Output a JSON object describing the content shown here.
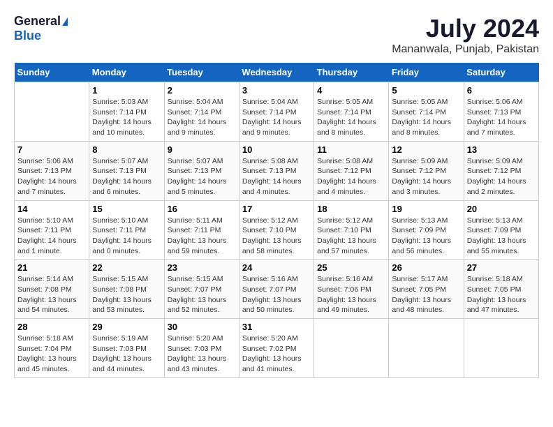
{
  "header": {
    "logo_general": "General",
    "logo_blue": "Blue",
    "month_title": "July 2024",
    "location": "Mananwala, Punjab, Pakistan"
  },
  "weekdays": [
    "Sunday",
    "Monday",
    "Tuesday",
    "Wednesday",
    "Thursday",
    "Friday",
    "Saturday"
  ],
  "weeks": [
    [
      {
        "day": null
      },
      {
        "day": "1",
        "sunrise": "5:03 AM",
        "sunset": "7:14 PM",
        "daylight": "14 hours and 10 minutes."
      },
      {
        "day": "2",
        "sunrise": "5:04 AM",
        "sunset": "7:14 PM",
        "daylight": "14 hours and 9 minutes."
      },
      {
        "day": "3",
        "sunrise": "5:04 AM",
        "sunset": "7:14 PM",
        "daylight": "14 hours and 9 minutes."
      },
      {
        "day": "4",
        "sunrise": "5:05 AM",
        "sunset": "7:14 PM",
        "daylight": "14 hours and 8 minutes."
      },
      {
        "day": "5",
        "sunrise": "5:05 AM",
        "sunset": "7:14 PM",
        "daylight": "14 hours and 8 minutes."
      },
      {
        "day": "6",
        "sunrise": "5:06 AM",
        "sunset": "7:13 PM",
        "daylight": "14 hours and 7 minutes."
      }
    ],
    [
      {
        "day": "7",
        "sunrise": "5:06 AM",
        "sunset": "7:13 PM",
        "daylight": "14 hours and 7 minutes."
      },
      {
        "day": "8",
        "sunrise": "5:07 AM",
        "sunset": "7:13 PM",
        "daylight": "14 hours and 6 minutes."
      },
      {
        "day": "9",
        "sunrise": "5:07 AM",
        "sunset": "7:13 PM",
        "daylight": "14 hours and 5 minutes."
      },
      {
        "day": "10",
        "sunrise": "5:08 AM",
        "sunset": "7:13 PM",
        "daylight": "14 hours and 4 minutes."
      },
      {
        "day": "11",
        "sunrise": "5:08 AM",
        "sunset": "7:12 PM",
        "daylight": "14 hours and 4 minutes."
      },
      {
        "day": "12",
        "sunrise": "5:09 AM",
        "sunset": "7:12 PM",
        "daylight": "14 hours and 3 minutes."
      },
      {
        "day": "13",
        "sunrise": "5:09 AM",
        "sunset": "7:12 PM",
        "daylight": "14 hours and 2 minutes."
      }
    ],
    [
      {
        "day": "14",
        "sunrise": "5:10 AM",
        "sunset": "7:11 PM",
        "daylight": "14 hours and 1 minute."
      },
      {
        "day": "15",
        "sunrise": "5:10 AM",
        "sunset": "7:11 PM",
        "daylight": "14 hours and 0 minutes."
      },
      {
        "day": "16",
        "sunrise": "5:11 AM",
        "sunset": "7:11 PM",
        "daylight": "13 hours and 59 minutes."
      },
      {
        "day": "17",
        "sunrise": "5:12 AM",
        "sunset": "7:10 PM",
        "daylight": "13 hours and 58 minutes."
      },
      {
        "day": "18",
        "sunrise": "5:12 AM",
        "sunset": "7:10 PM",
        "daylight": "13 hours and 57 minutes."
      },
      {
        "day": "19",
        "sunrise": "5:13 AM",
        "sunset": "7:09 PM",
        "daylight": "13 hours and 56 minutes."
      },
      {
        "day": "20",
        "sunrise": "5:13 AM",
        "sunset": "7:09 PM",
        "daylight": "13 hours and 55 minutes."
      }
    ],
    [
      {
        "day": "21",
        "sunrise": "5:14 AM",
        "sunset": "7:08 PM",
        "daylight": "13 hours and 54 minutes."
      },
      {
        "day": "22",
        "sunrise": "5:15 AM",
        "sunset": "7:08 PM",
        "daylight": "13 hours and 53 minutes."
      },
      {
        "day": "23",
        "sunrise": "5:15 AM",
        "sunset": "7:07 PM",
        "daylight": "13 hours and 52 minutes."
      },
      {
        "day": "24",
        "sunrise": "5:16 AM",
        "sunset": "7:07 PM",
        "daylight": "13 hours and 50 minutes."
      },
      {
        "day": "25",
        "sunrise": "5:16 AM",
        "sunset": "7:06 PM",
        "daylight": "13 hours and 49 minutes."
      },
      {
        "day": "26",
        "sunrise": "5:17 AM",
        "sunset": "7:05 PM",
        "daylight": "13 hours and 48 minutes."
      },
      {
        "day": "27",
        "sunrise": "5:18 AM",
        "sunset": "7:05 PM",
        "daylight": "13 hours and 47 minutes."
      }
    ],
    [
      {
        "day": "28",
        "sunrise": "5:18 AM",
        "sunset": "7:04 PM",
        "daylight": "13 hours and 45 minutes."
      },
      {
        "day": "29",
        "sunrise": "5:19 AM",
        "sunset": "7:03 PM",
        "daylight": "13 hours and 44 minutes."
      },
      {
        "day": "30",
        "sunrise": "5:20 AM",
        "sunset": "7:03 PM",
        "daylight": "13 hours and 43 minutes."
      },
      {
        "day": "31",
        "sunrise": "5:20 AM",
        "sunset": "7:02 PM",
        "daylight": "13 hours and 41 minutes."
      },
      {
        "day": null
      },
      {
        "day": null
      },
      {
        "day": null
      }
    ]
  ],
  "labels": {
    "sunrise": "Sunrise:",
    "sunset": "Sunset:",
    "daylight": "Daylight:"
  }
}
